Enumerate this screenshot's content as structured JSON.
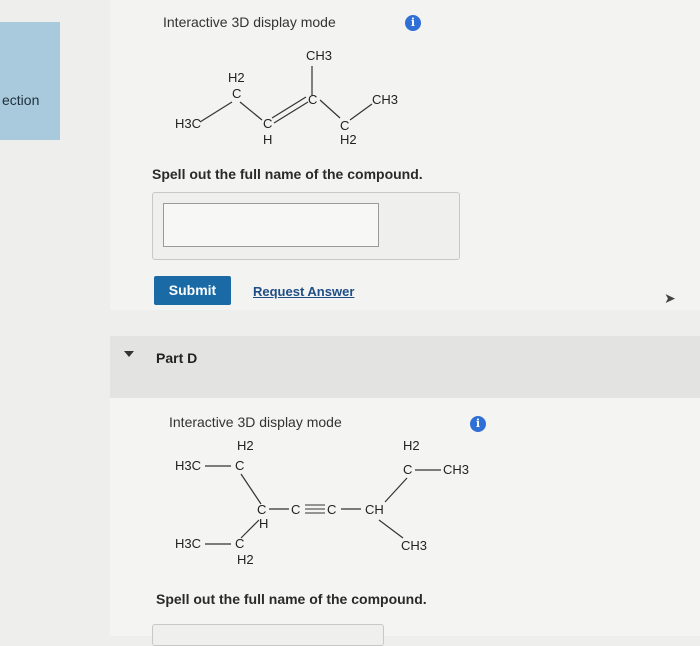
{
  "sidebar": {
    "label": "ection"
  },
  "part_c": {
    "mode_label": "Interactive 3D display mode",
    "info_icon": "i",
    "structure": {
      "ch3_top": "CH3",
      "h2_left": "H2",
      "c_left": "C",
      "h3c": "H3C",
      "c_mid": "C",
      "h_mid": "H",
      "c_right": "C",
      "ch3_right": "CH3",
      "c_low": "C",
      "h2_low": "H2"
    },
    "prompt": "Spell out the full name of the compound.",
    "answer_value": "",
    "submit_label": "Submit",
    "request_label": "Request Answer"
  },
  "part_d": {
    "title": "Part D",
    "mode_label": "Interactive 3D display mode",
    "info_icon": "i",
    "structure": {
      "h2_tl": "H2",
      "h3c_tl": "H3C",
      "c_tl": "C",
      "h2_tr": "H2",
      "c_tr": "C",
      "ch3_tr": "CH3",
      "chain": "C",
      "triple": "C",
      "triple2": "C",
      "ch": "CH",
      "h_chain": "H",
      "h3c_bl": "H3C",
      "c_bl": "C",
      "h2_bl": "H2",
      "ch3_br": "CH3"
    },
    "prompt": "Spell out the full name of the compound."
  },
  "colors": {
    "accent": "#1a6aa6",
    "info": "#2f6fd6",
    "sidebar": "#a9c9dc"
  }
}
